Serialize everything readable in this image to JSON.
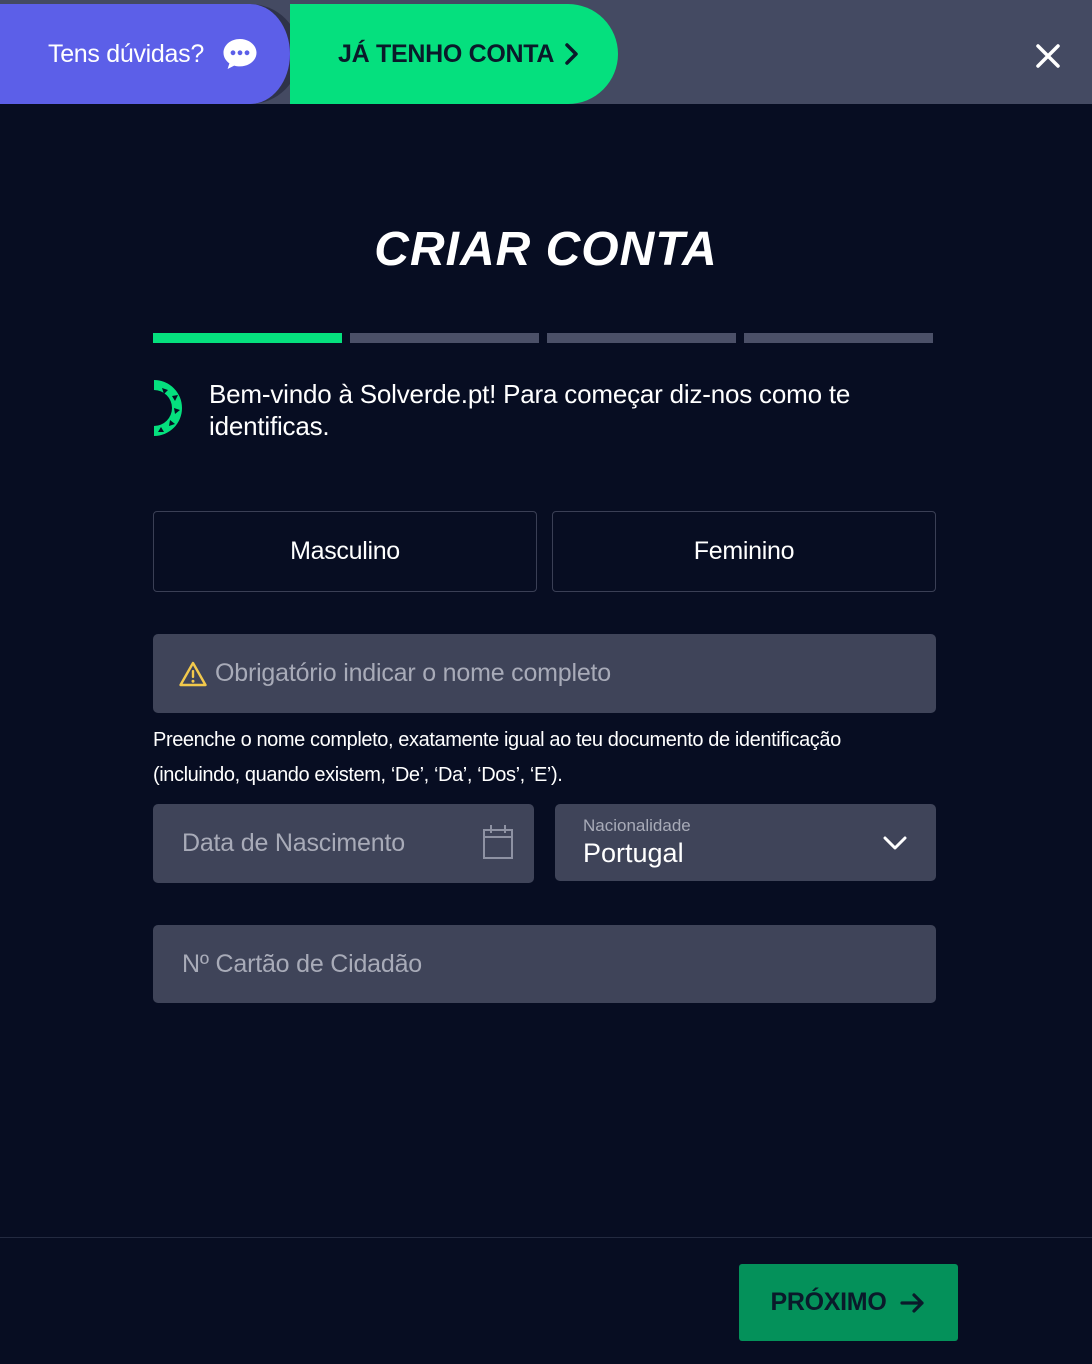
{
  "topbar": {
    "help_label": "Tens dúvidas?",
    "account_label": "JÁ TENHO CONTA",
    "close_icon": "close-icon"
  },
  "title": "CRIAR CONTA",
  "progress": {
    "current_step": 1,
    "total_steps": 4
  },
  "welcome": {
    "text": "Bem-vindo à Solverde.pt! Para começar diz-nos como te identificas."
  },
  "gender": {
    "male_label": "Masculino",
    "female_label": "Feminino"
  },
  "name_field": {
    "placeholder": "Obrigatório indicar o nome completo",
    "icon": "warning-icon"
  },
  "name_hint": "Preenche o nome completo, exatamente igual ao teu documento de identificação (incluindo, quando existem, ‘De’, ‘Da’, ‘Dos’, ‘E’).",
  "dob_field": {
    "placeholder": "Data de Nascimento",
    "icon": "calendar-icon"
  },
  "nationality": {
    "label": "Nacionalidade",
    "value": "Portugal"
  },
  "cc_field": {
    "placeholder": "Nº Cartão de Cidadão"
  },
  "next_button": {
    "label": "PRÓXIMO"
  },
  "colors": {
    "background": "#070d22",
    "accent_green": "#05e07e",
    "help_purple": "#5c5fe8",
    "field_bg": "#3f4459",
    "next_button_bg": "#04915a"
  }
}
